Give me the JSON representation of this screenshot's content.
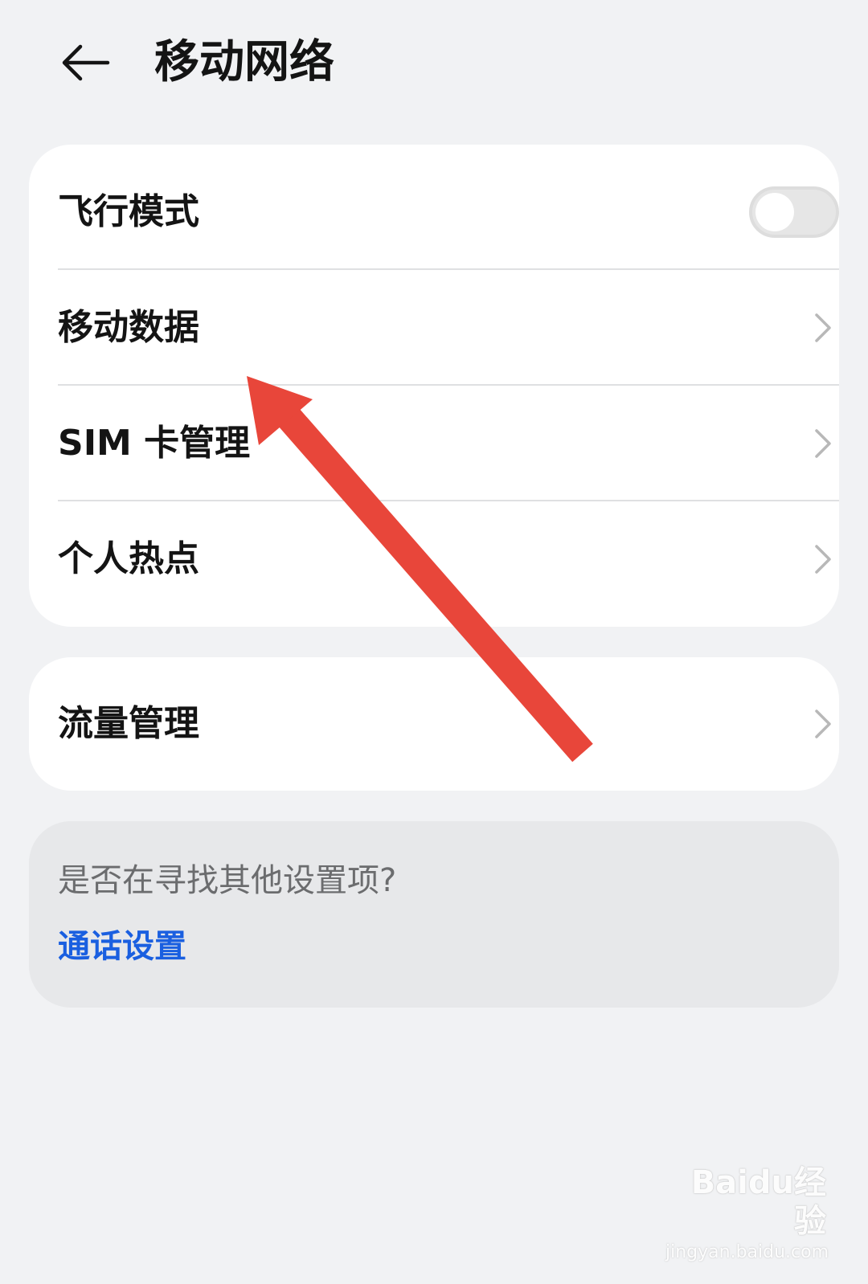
{
  "header": {
    "title": "移动网络",
    "back_icon": "arrow-left-icon"
  },
  "main_card": {
    "items": [
      {
        "label": "飞行模式",
        "control": "toggle",
        "toggle_on": false
      },
      {
        "label": "移动数据",
        "control": "chevron"
      },
      {
        "label": "SIM 卡管理",
        "control": "chevron"
      },
      {
        "label": "个人热点",
        "control": "chevron"
      }
    ]
  },
  "traffic_card": {
    "label": "流量管理",
    "control": "chevron"
  },
  "suggestion": {
    "question": "是否在寻找其他设置项?",
    "link": "通话设置"
  },
  "annotation": {
    "color": "#e8463a"
  },
  "watermark": {
    "logo": "Baidu经验",
    "url": "jingyan.baidu.com"
  },
  "colors": {
    "background": "#f1f2f4",
    "card": "#ffffff",
    "link": "#1a5fe0"
  }
}
